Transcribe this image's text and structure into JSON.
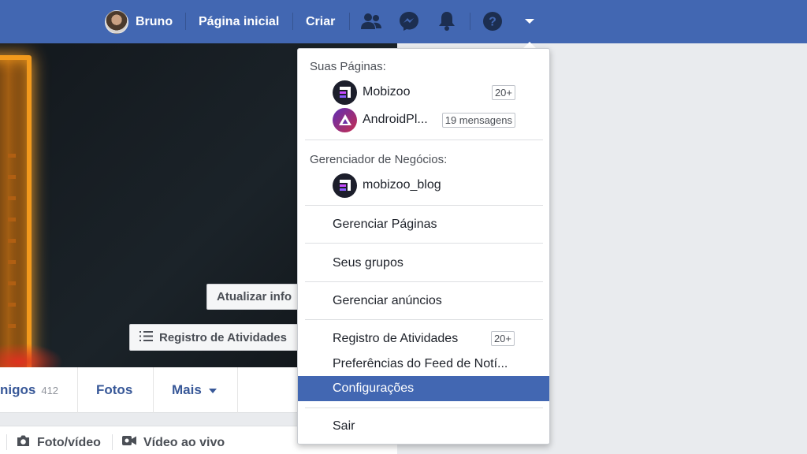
{
  "topbar": {
    "user_name": "Bruno",
    "home_label": "Página inicial",
    "create_label": "Criar",
    "icons": [
      "friends-icon",
      "messenger-icon",
      "notifications-icon",
      "help-icon",
      "dropdown-arrow-icon"
    ],
    "bar_color": "#4267b2"
  },
  "cover": {
    "update_info_label": "Atualizar info",
    "activity_log_label": "Registro de Atividades"
  },
  "profile_tabs": {
    "friends_label": "nigos",
    "friends_count": "412",
    "photos_label": "Fotos",
    "more_label": "Mais"
  },
  "composer": {
    "photo_video_label": "Foto/vídeo",
    "live_video_label": "Vídeo ao vivo"
  },
  "menu": {
    "your_pages_title": "Suas Páginas:",
    "pages": [
      {
        "name": "Mobizoo",
        "badge": "20+"
      },
      {
        "name": "AndroidPl...",
        "badge": "19 mensagens"
      }
    ],
    "business_title": "Gerenciador de Negócios:",
    "business_items": [
      {
        "name": "mobizoo_blog"
      }
    ],
    "items": [
      {
        "label": "Gerenciar Páginas"
      },
      {
        "label": "Seus grupos"
      },
      {
        "label": "Gerenciar anúncios"
      },
      {
        "label": "Registro de Atividades",
        "badge": "20+"
      },
      {
        "label": "Preferências do Feed de Notí..."
      },
      {
        "label": "Configurações"
      },
      {
        "label": "Sair"
      }
    ],
    "active_color": "#4267b2"
  }
}
